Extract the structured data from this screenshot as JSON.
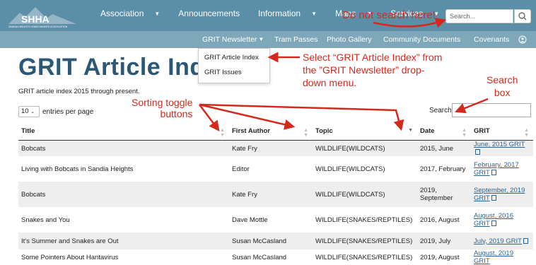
{
  "header": {
    "logo_text": "SHHA",
    "logo_subtext": "SANDIA HEIGHTS HOMEOWNERS ASSOCIATION",
    "nav": [
      {
        "label": "Association",
        "caret": true
      },
      {
        "label": "Announcements",
        "caret": false
      },
      {
        "label": "Information",
        "caret": true
      },
      {
        "label": "Maps",
        "caret": true
      },
      {
        "label": "Services",
        "caret": true
      }
    ],
    "search_placeholder": "Search..."
  },
  "subnav": {
    "items": [
      {
        "label": "GRIT Newsletter",
        "caret": true
      },
      {
        "label": "Tram Passes"
      },
      {
        "label": "Photo Gallery"
      },
      {
        "label": "Community Documents"
      },
      {
        "label": "Covenants"
      }
    ]
  },
  "dropdown": {
    "items": [
      "GRIT Article Index",
      "GRIT Issues"
    ]
  },
  "page": {
    "title": "GRIT Article Index",
    "intro": "GRIT article index 2015 through present.",
    "entries_value": "10",
    "entries_label": "entries per page",
    "search_label": "Search:"
  },
  "table": {
    "columns": [
      "Title",
      "First Author",
      "Topic",
      "Date",
      "GRIT"
    ],
    "rows": [
      {
        "title": "Bobcats",
        "author": "Kate Fry",
        "topic": "WILDLIFE(WILDCATS)",
        "date": "2015, June",
        "grit": "June, 2015 GRIT"
      },
      {
        "title": "Living with Bobcats in Sandia Heights",
        "author": "Editor",
        "topic": "WILDLIFE(WILDCATS)",
        "date": "2017, February",
        "grit": "February, 2017 GRIT"
      },
      {
        "title": "Bobcats",
        "author": "Kate Fry",
        "topic": "WILDLIFE(WILDCATS)",
        "date": "2019, September",
        "grit": "September, 2019 GRIT"
      },
      {
        "title": "Snakes and You",
        "author": "Dave Mottle",
        "topic": "WILDLIFE(SNAKES/REPTILES)",
        "date": "2016, August",
        "grit": "August, 2016 GRIT"
      },
      {
        "title": "It's Summer and Snakes are Out",
        "author": "Susan McCasland",
        "topic": "WILDLIFE(SNAKES/REPTILES)",
        "date": "2019, July",
        "grit": "July, 2019 GRIT"
      },
      {
        "title": "Some Pointers About Hantavirus",
        "author": "Susan McCasland",
        "topic": "WILDLIFE(SNAKES/REPTILES)",
        "date": "2019, August",
        "grit": "August, 2019 GRIT"
      }
    ]
  },
  "annotations": {
    "no_search": "Do not search here!",
    "select_line1": "Select “GRIT Article Index” from",
    "select_line2": "the ”GRIT Newsletter” drop-",
    "select_line3": "down menu.",
    "search_box_line1": "Search",
    "search_box_line2": "box",
    "sorting_line1": "Sorting toggle",
    "sorting_line2": "buttons",
    "color": "#d42a1e"
  }
}
